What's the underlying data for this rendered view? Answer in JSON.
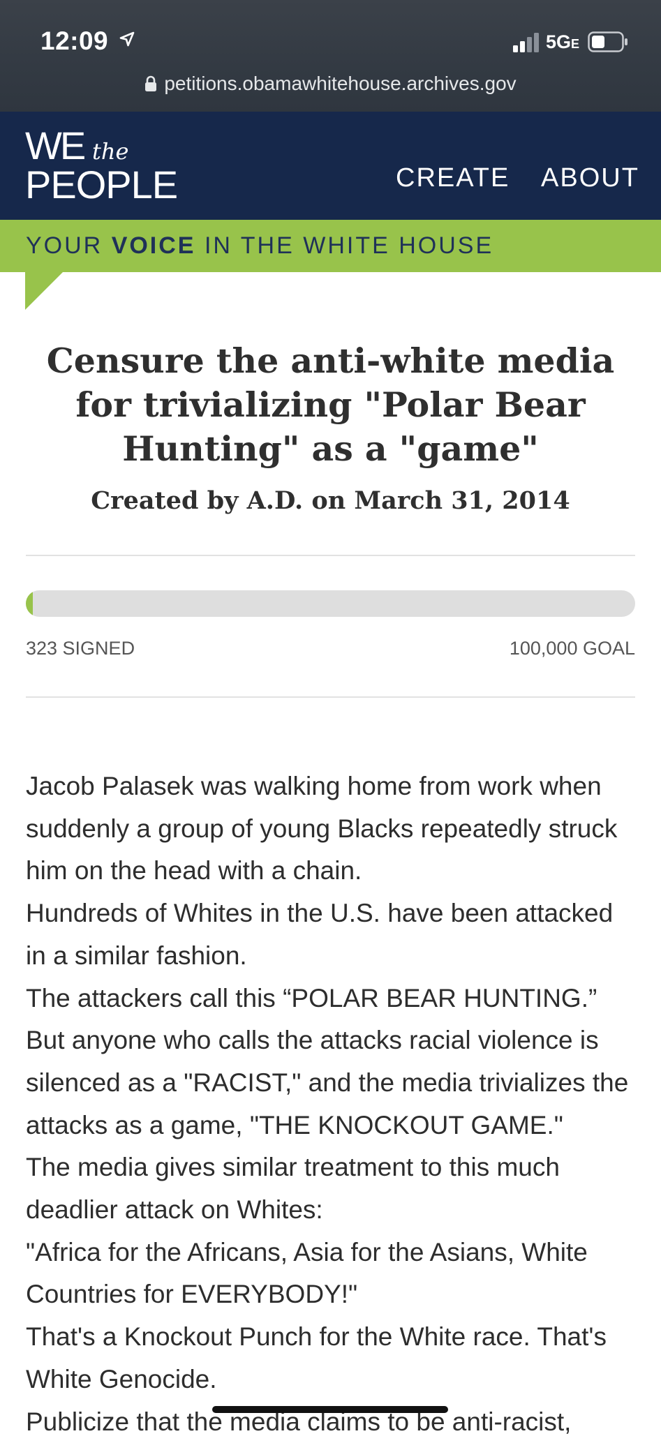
{
  "status_bar": {
    "time": "12:09",
    "network": "5G",
    "network_suffix": "E",
    "url": "petitions.obamawhitehouse.archives.gov"
  },
  "header": {
    "logo_line1": "WE",
    "logo_the": "the",
    "logo_line2": "PEOPLE",
    "nav": {
      "create": "CREATE",
      "about": "ABOUT"
    }
  },
  "tagline": {
    "part1": "YOUR ",
    "bold": "VOICE",
    "part2": " IN THE WHITE HOUSE"
  },
  "petition": {
    "title": "Censure the anti-white media for trivializing \"Polar Bear Hunting\" as a \"game\"",
    "created": "Created by A.D. on March 31, 2014",
    "signed_label": "323 SIGNED",
    "goal_label": "100,000 GOAL",
    "signed_count": 323,
    "goal_count": 100000
  },
  "body": {
    "paragraphs": [
      "Jacob Palasek was walking home from work when suddenly a group of young Blacks repeatedly struck him on the head with a chain.",
      "Hundreds of Whites in the U.S. have been attacked in a similar fashion.",
      "The attackers call this “POLAR BEAR HUNTING.”",
      "But anyone who calls the attacks racial violence is silenced as a \"RACIST,\" and the media trivializes the attacks as a game, \"THE KNOCKOUT GAME.\"",
      "The media gives similar treatment to this much deadlier attack on Whites:",
      "\"Africa for the Africans, Asia for the Asians, White Countries for EVERYBODY!\"",
      "That's a Knockout Punch for the White race. That's White Genocide.",
      "Publicize that the media claims to be anti-racist,"
    ]
  },
  "colors": {
    "navy": "#16284b",
    "green": "#98c34b",
    "progress_track": "#dedede"
  }
}
